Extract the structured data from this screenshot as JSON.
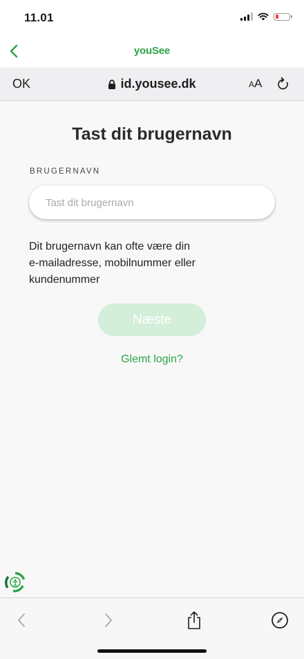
{
  "status_bar": {
    "time": "11.01",
    "battery_level": 0.2
  },
  "app_bar": {
    "brand": "youSee",
    "back_icon": "chevron-left-icon"
  },
  "url_bar": {
    "done_label": "OK",
    "url": "id.yousee.dk",
    "text_size_small": "A",
    "text_size_large": "A",
    "lock_icon": "lock-icon",
    "reload_icon": "reload-icon"
  },
  "form": {
    "heading": "Tast dit brugernavn",
    "field_label": "BRUGERNAVN",
    "username_value": "",
    "username_placeholder": "Tast dit brugernavn",
    "hint_lines": [
      "Dit brugernavn kan ofte være din",
      "e-mailadresse, mobilnummer eller",
      "kundenummer"
    ],
    "next_label": "Næste",
    "forgot_label": "Glemt login?"
  },
  "toolbar": {
    "items": [
      "back-icon",
      "forward-icon",
      "share-icon",
      "compass-icon"
    ]
  },
  "colors": {
    "brand_green": "#2aa547",
    "button_disabled": "#d3eed9",
    "background": "#f8f8f8"
  }
}
